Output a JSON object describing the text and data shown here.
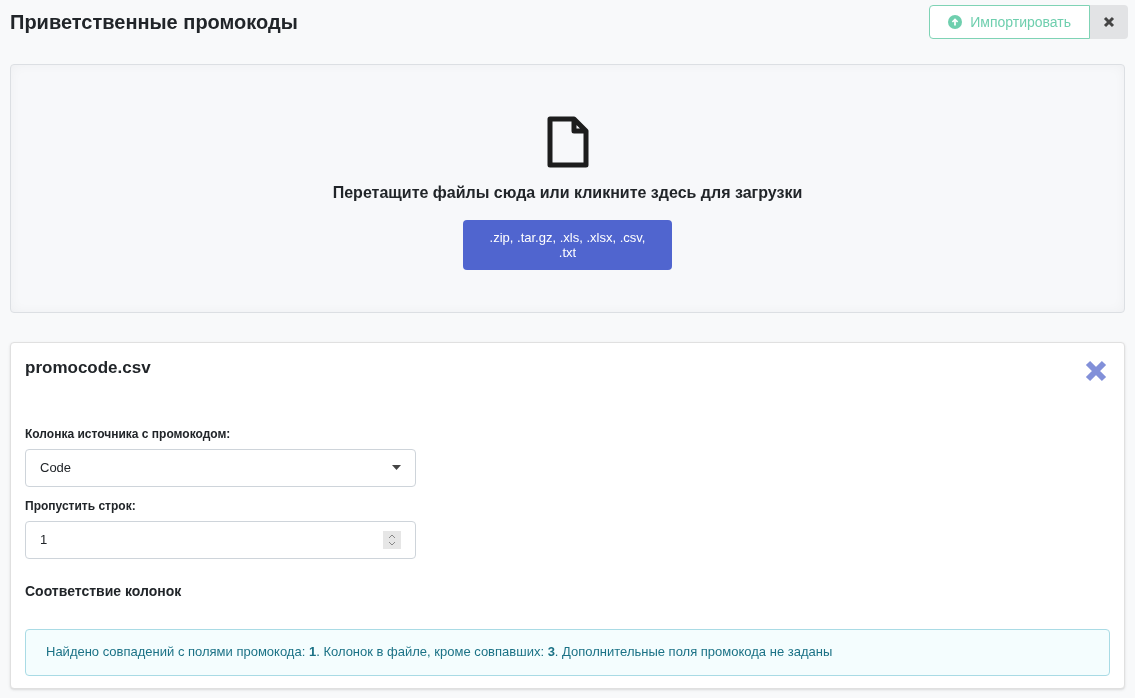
{
  "header": {
    "title": "Приветственные промокоды",
    "import_button": "Импортировать"
  },
  "dropzone": {
    "prompt": "Перетащите файлы сюда или кликните здесь для загрузки",
    "formats": ".zip, .tar.gz, .xls, .xlsx, .csv, .txt"
  },
  "file_card": {
    "filename": "promocode.csv",
    "source_column": {
      "label": "Колонка источника с промокодом:",
      "value": "Code"
    },
    "skip_rows": {
      "label": "Пропустить строк:",
      "value": "1"
    },
    "mapping_title": "Соответствие колонок",
    "info": "Найдено совпадений с полями промокода: **1**. Колонок в файле, кроме совпавших: **3**. Дополнительные поля промокода не заданы"
  }
}
